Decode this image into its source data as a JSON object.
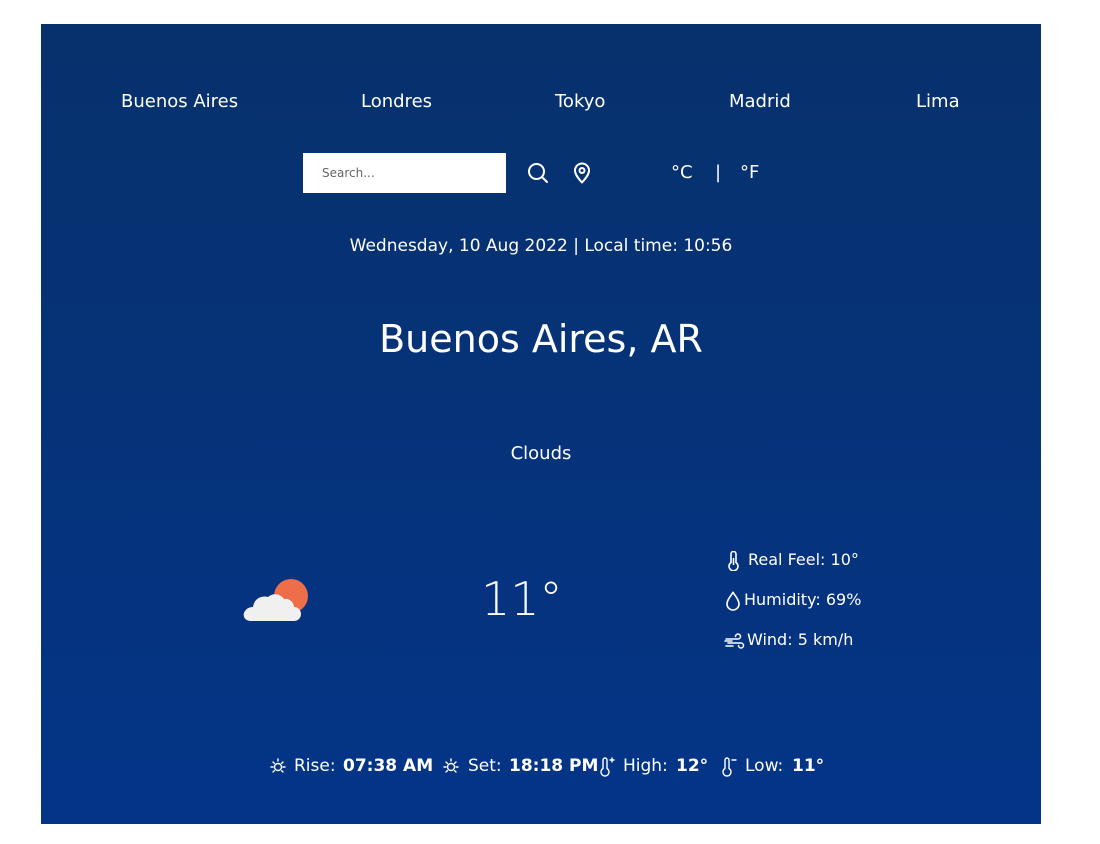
{
  "top_nav": {
    "cities": [
      "Buenos Aires",
      "Londres",
      "Tokyo",
      "Madrid",
      "Lima"
    ]
  },
  "search": {
    "placeholder": "Search...",
    "value": ""
  },
  "units": {
    "celsius": "°C",
    "separator": "|",
    "fahrenheit": "°F"
  },
  "datetime": "Wednesday, 10 Aug 2022 | Local time: 10:56",
  "location": "Buenos Aires, AR",
  "condition": "Clouds",
  "current": {
    "temperature": "11°",
    "icon": "cloud-sun-icon",
    "real_feel": "Real Feel: 10°",
    "humidity": "Humidity: 69%",
    "wind": "Wind: 5 km/h"
  },
  "summary": {
    "rise_label": "Rise:",
    "rise_value": "07:38 AM",
    "set_label": "Set:",
    "set_value": "18:18 PM",
    "high_label": "High:",
    "high_value": "12°",
    "low_label": "Low:",
    "low_value": "11°"
  },
  "colors": {
    "background_top": "#07316c",
    "background_bottom": "#043487",
    "sun": "#ee6e4a",
    "cloud": "#f0f0f0",
    "text": "#ffffff"
  }
}
